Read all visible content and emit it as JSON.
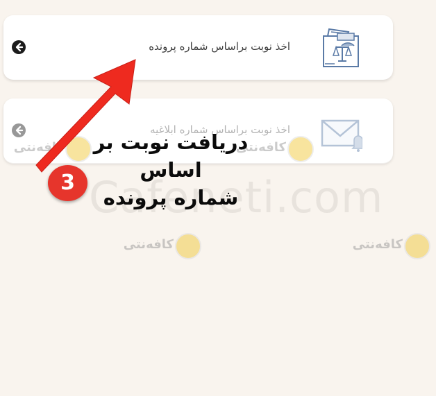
{
  "cards": [
    {
      "label": "اخذ نوبت براساس شماره پرونده",
      "icon": "legal-document-icon",
      "arrow": "arrow-left-circle-icon"
    },
    {
      "label": "اخذ نوبت براساس شماره ابلاغیه",
      "icon": "envelope-bell-icon",
      "arrow": "arrow-left-circle-icon"
    }
  ],
  "annotation": {
    "caption_line1": "دریافت نوبت بر اساس",
    "caption_line2": "شماره پرونده",
    "step_number": "3",
    "arrow_color": "#e6352c"
  },
  "watermark": {
    "site": "Cafeneti.com",
    "logo_word": "کافه‌نتی"
  },
  "colors": {
    "background": "#f9f4ee",
    "card": "#ffffff",
    "icon": "#5a7aa6",
    "badge": "#e6352c"
  }
}
